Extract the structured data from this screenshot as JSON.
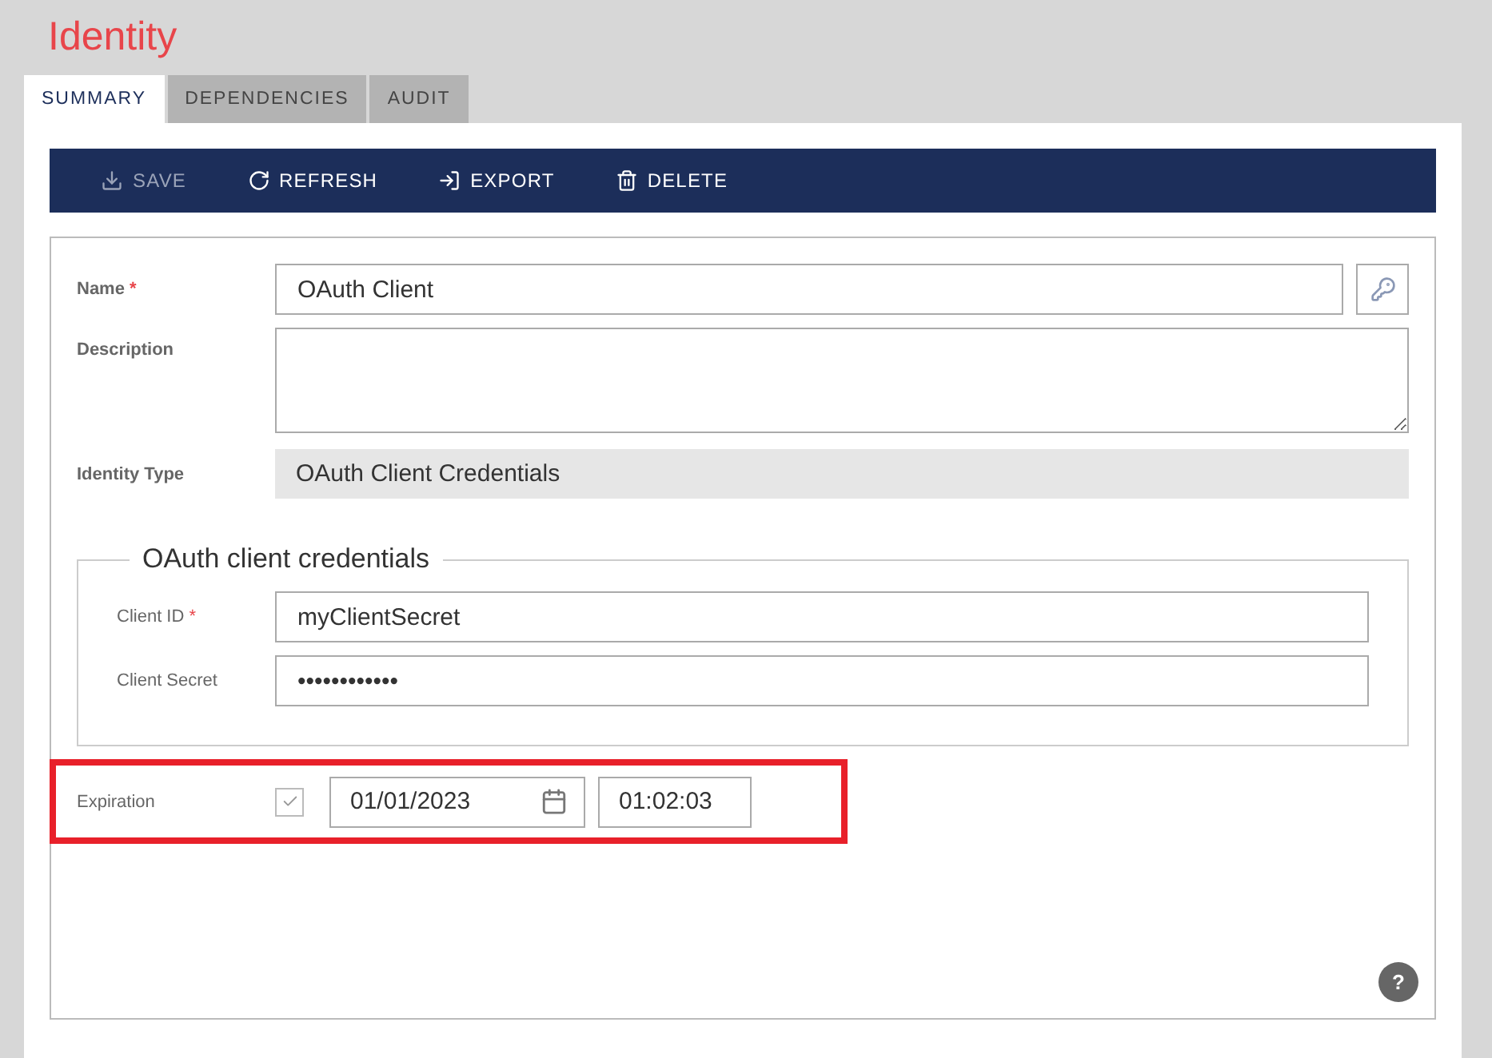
{
  "page_title": "Identity",
  "tabs": [
    {
      "label": "SUMMARY",
      "selected": true
    },
    {
      "label": "DEPENDENCIES",
      "selected": false
    },
    {
      "label": "AUDIT",
      "selected": false
    }
  ],
  "toolbar": [
    {
      "label": "SAVE",
      "kind": "save",
      "disabled": true
    },
    {
      "label": "REFRESH",
      "kind": "refresh",
      "disabled": false
    },
    {
      "label": "EXPORT",
      "kind": "export",
      "disabled": false
    },
    {
      "label": "DELETE",
      "kind": "delete",
      "disabled": false
    }
  ],
  "fields": [
    {
      "label": "Name",
      "required_mark": "*",
      "kind": "text",
      "value": "OAuth Client"
    },
    {
      "label": "Description",
      "kind": "textarea"
    },
    {
      "label": "Identity Type",
      "kind": "readonly",
      "value": "OAuth Client Credentials"
    }
  ],
  "credentials": {
    "legend": "OAuth client credentials",
    "fields": [
      {
        "label": "Client ID",
        "required_mark": "*",
        "value": "myClientSecret"
      },
      {
        "label": "Client Secret",
        "value": "••••••••••••"
      }
    ]
  },
  "expiration": {
    "label": "Expiration",
    "checked": true,
    "highlighted": true,
    "date": "01/01/2023",
    "time": "01:02:03"
  },
  "help": "?"
}
